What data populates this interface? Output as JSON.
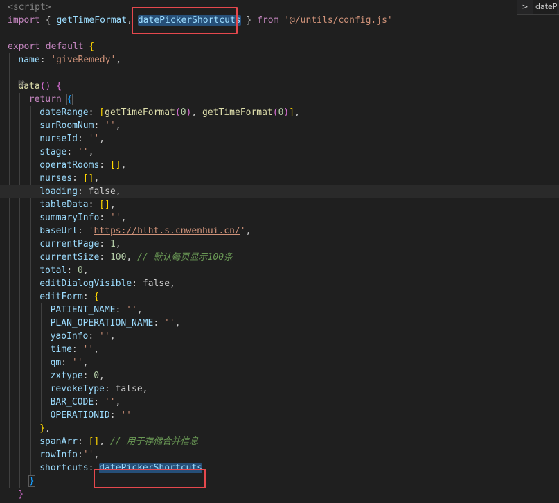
{
  "editor": {
    "codelens_label": "除",
    "codelens_chevron": "⌵",
    "sticky_widget": {
      "chevron": ">",
      "text": "dateP"
    },
    "lines": [
      {
        "indent": 0,
        "tokens": [
          [
            "tag",
            "<script>"
          ]
        ]
      },
      {
        "indent": 0,
        "tokens": [
          [
            "kw",
            "import"
          ],
          [
            "punc",
            " { "
          ],
          [
            "id",
            "getTimeFormat"
          ],
          [
            "punc",
            ", "
          ],
          [
            "sym",
            "datePickerShortcuts"
          ],
          [
            "punc",
            " } "
          ],
          [
            "kw",
            "from"
          ],
          [
            "punc",
            " "
          ],
          [
            "str",
            "'@/untils/config.js'"
          ]
        ]
      },
      {
        "indent": 0,
        "tokens": []
      },
      {
        "indent": 0,
        "tokens": [
          [
            "kw",
            "export"
          ],
          [
            "punc",
            " "
          ],
          [
            "kw",
            "default"
          ],
          [
            "punc",
            " "
          ],
          [
            "b1",
            "{"
          ]
        ]
      },
      {
        "indent": 1,
        "tokens": [
          [
            "prop",
            "name"
          ],
          [
            "punc",
            ": "
          ],
          [
            "str",
            "'giveRemedy'"
          ],
          [
            "punc",
            ","
          ]
        ]
      },
      {
        "indent": 0,
        "tokens": [],
        "lens": true
      },
      {
        "indent": 1,
        "tokens": [
          [
            "fn",
            "data"
          ],
          [
            "b2",
            "()"
          ],
          [
            "punc",
            " "
          ],
          [
            "b2",
            "{"
          ]
        ]
      },
      {
        "indent": 2,
        "tokens": [
          [
            "ctl",
            "return"
          ],
          [
            "punc",
            " "
          ],
          [
            "b3box",
            "{"
          ]
        ]
      },
      {
        "indent": 3,
        "tokens": [
          [
            "prop",
            "dateRange"
          ],
          [
            "punc",
            ": "
          ],
          [
            "b1",
            "["
          ],
          [
            "fn",
            "getTimeFormat"
          ],
          [
            "b2",
            "("
          ],
          [
            "num",
            "0"
          ],
          [
            "b2",
            ")"
          ],
          [
            "punc",
            ", "
          ],
          [
            "fn",
            "getTimeFormat"
          ],
          [
            "b2",
            "("
          ],
          [
            "num",
            "0"
          ],
          [
            "b2",
            ")"
          ],
          [
            "b1",
            "]"
          ],
          [
            "punc",
            ","
          ]
        ]
      },
      {
        "indent": 3,
        "tokens": [
          [
            "prop",
            "surRoomNum"
          ],
          [
            "punc",
            ": "
          ],
          [
            "str",
            "''"
          ],
          [
            "punc",
            ","
          ]
        ]
      },
      {
        "indent": 3,
        "tokens": [
          [
            "prop",
            "nurseId"
          ],
          [
            "punc",
            ": "
          ],
          [
            "str",
            "''"
          ],
          [
            "punc",
            ","
          ]
        ]
      },
      {
        "indent": 3,
        "tokens": [
          [
            "prop",
            "stage"
          ],
          [
            "punc",
            ": "
          ],
          [
            "str",
            "''"
          ],
          [
            "punc",
            ","
          ]
        ]
      },
      {
        "indent": 3,
        "tokens": [
          [
            "prop",
            "operatRooms"
          ],
          [
            "punc",
            ": "
          ],
          [
            "b1",
            "[]"
          ],
          [
            "punc",
            ","
          ]
        ]
      },
      {
        "indent": 3,
        "tokens": [
          [
            "prop",
            "nurses"
          ],
          [
            "punc",
            ": "
          ],
          [
            "b1",
            "[]"
          ],
          [
            "punc",
            ","
          ]
        ]
      },
      {
        "indent": 3,
        "tokens": [
          [
            "prop",
            "loading"
          ],
          [
            "punc",
            ": "
          ],
          [
            "bool",
            "false"
          ],
          [
            "punc",
            ","
          ]
        ],
        "current": true
      },
      {
        "indent": 3,
        "tokens": [
          [
            "prop",
            "tableData"
          ],
          [
            "punc",
            ": "
          ],
          [
            "b1",
            "[]"
          ],
          [
            "punc",
            ","
          ]
        ]
      },
      {
        "indent": 3,
        "tokens": [
          [
            "prop",
            "summaryInfo"
          ],
          [
            "punc",
            ": "
          ],
          [
            "str",
            "''"
          ],
          [
            "punc",
            ","
          ]
        ]
      },
      {
        "indent": 3,
        "tokens": [
          [
            "prop",
            "baseUrl"
          ],
          [
            "punc",
            ": "
          ],
          [
            "str",
            "'"
          ],
          [
            "link",
            "https://hlht.s.cnwenhui.cn/"
          ],
          [
            "str",
            "'"
          ],
          [
            "punc",
            ","
          ]
        ]
      },
      {
        "indent": 3,
        "tokens": [
          [
            "prop",
            "currentPage"
          ],
          [
            "punc",
            ": "
          ],
          [
            "num",
            "1"
          ],
          [
            "punc",
            ","
          ]
        ]
      },
      {
        "indent": 3,
        "tokens": [
          [
            "prop",
            "currentSize"
          ],
          [
            "punc",
            ": "
          ],
          [
            "num",
            "100"
          ],
          [
            "punc",
            ", "
          ],
          [
            "cmt",
            "// 默认每页显示100条"
          ]
        ]
      },
      {
        "indent": 3,
        "tokens": [
          [
            "prop",
            "total"
          ],
          [
            "punc",
            ": "
          ],
          [
            "num",
            "0"
          ],
          [
            "punc",
            ","
          ]
        ]
      },
      {
        "indent": 3,
        "tokens": [
          [
            "prop",
            "editDialogVisible"
          ],
          [
            "punc",
            ": "
          ],
          [
            "bool",
            "false"
          ],
          [
            "punc",
            ","
          ]
        ]
      },
      {
        "indent": 3,
        "tokens": [
          [
            "prop",
            "editForm"
          ],
          [
            "punc",
            ": "
          ],
          [
            "b1",
            "{"
          ]
        ]
      },
      {
        "indent": 4,
        "tokens": [
          [
            "prop",
            "PATIENT_NAME"
          ],
          [
            "punc",
            ": "
          ],
          [
            "str",
            "''"
          ],
          [
            "punc",
            ","
          ]
        ]
      },
      {
        "indent": 4,
        "tokens": [
          [
            "prop",
            "PLAN_OPERATION_NAME"
          ],
          [
            "punc",
            ": "
          ],
          [
            "str",
            "''"
          ],
          [
            "punc",
            ","
          ]
        ]
      },
      {
        "indent": 4,
        "tokens": [
          [
            "prop",
            "yaoInfo"
          ],
          [
            "punc",
            ": "
          ],
          [
            "str",
            "''"
          ],
          [
            "punc",
            ","
          ]
        ]
      },
      {
        "indent": 4,
        "tokens": [
          [
            "prop",
            "time"
          ],
          [
            "punc",
            ": "
          ],
          [
            "str",
            "''"
          ],
          [
            "punc",
            ","
          ]
        ]
      },
      {
        "indent": 4,
        "tokens": [
          [
            "prop",
            "qm"
          ],
          [
            "punc",
            ": "
          ],
          [
            "str",
            "''"
          ],
          [
            "punc",
            ","
          ]
        ]
      },
      {
        "indent": 4,
        "tokens": [
          [
            "prop",
            "zxtype"
          ],
          [
            "punc",
            ": "
          ],
          [
            "num",
            "0"
          ],
          [
            "punc",
            ","
          ]
        ]
      },
      {
        "indent": 4,
        "tokens": [
          [
            "prop",
            "revokeType"
          ],
          [
            "punc",
            ": "
          ],
          [
            "bool",
            "false"
          ],
          [
            "punc",
            ","
          ]
        ]
      },
      {
        "indent": 4,
        "tokens": [
          [
            "prop",
            "BAR_CODE"
          ],
          [
            "punc",
            ": "
          ],
          [
            "str",
            "''"
          ],
          [
            "punc",
            ","
          ]
        ]
      },
      {
        "indent": 4,
        "tokens": [
          [
            "prop",
            "OPERATIONID"
          ],
          [
            "punc",
            ": "
          ],
          [
            "str",
            "''"
          ]
        ]
      },
      {
        "indent": 3,
        "tokens": [
          [
            "b1",
            "}"
          ],
          [
            "punc",
            ","
          ]
        ]
      },
      {
        "indent": 3,
        "tokens": [
          [
            "prop",
            "spanArr"
          ],
          [
            "punc",
            ": "
          ],
          [
            "b1",
            "[]"
          ],
          [
            "punc",
            ", "
          ],
          [
            "cmt",
            "// 用于存储合并信息"
          ]
        ]
      },
      {
        "indent": 3,
        "tokens": [
          [
            "prop",
            "rowInfo"
          ],
          [
            "punc",
            ":"
          ],
          [
            "str",
            "''"
          ],
          [
            "punc",
            ","
          ]
        ]
      },
      {
        "indent": 3,
        "tokens": [
          [
            "prop",
            "shortcuts"
          ],
          [
            "punc",
            ": "
          ],
          [
            "sym2",
            "datePickerShortcuts"
          ],
          [
            "punc",
            ","
          ]
        ]
      },
      {
        "indent": 2,
        "tokens": [
          [
            "b3box",
            "}"
          ]
        ]
      },
      {
        "indent": 1,
        "tokens": [
          [
            "b2",
            "}"
          ]
        ]
      }
    ]
  }
}
